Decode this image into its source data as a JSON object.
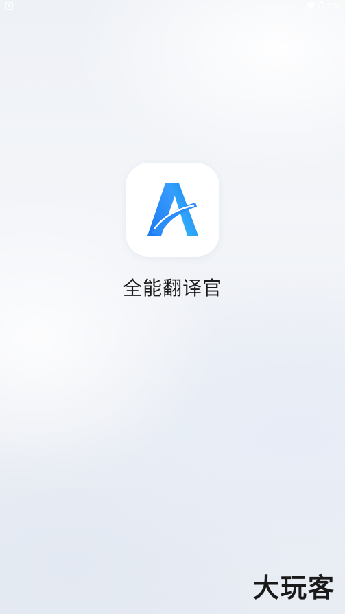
{
  "status_bar": {
    "time": "2:04",
    "icons": [
      "notification-icon",
      "wifi-icon",
      "battery-icon"
    ]
  },
  "splash": {
    "app_name": "全能翻译官",
    "icon": "letter-a-logo-icon",
    "accent_color": "#2f8cff"
  },
  "watermark": {
    "text": "大玩客"
  }
}
